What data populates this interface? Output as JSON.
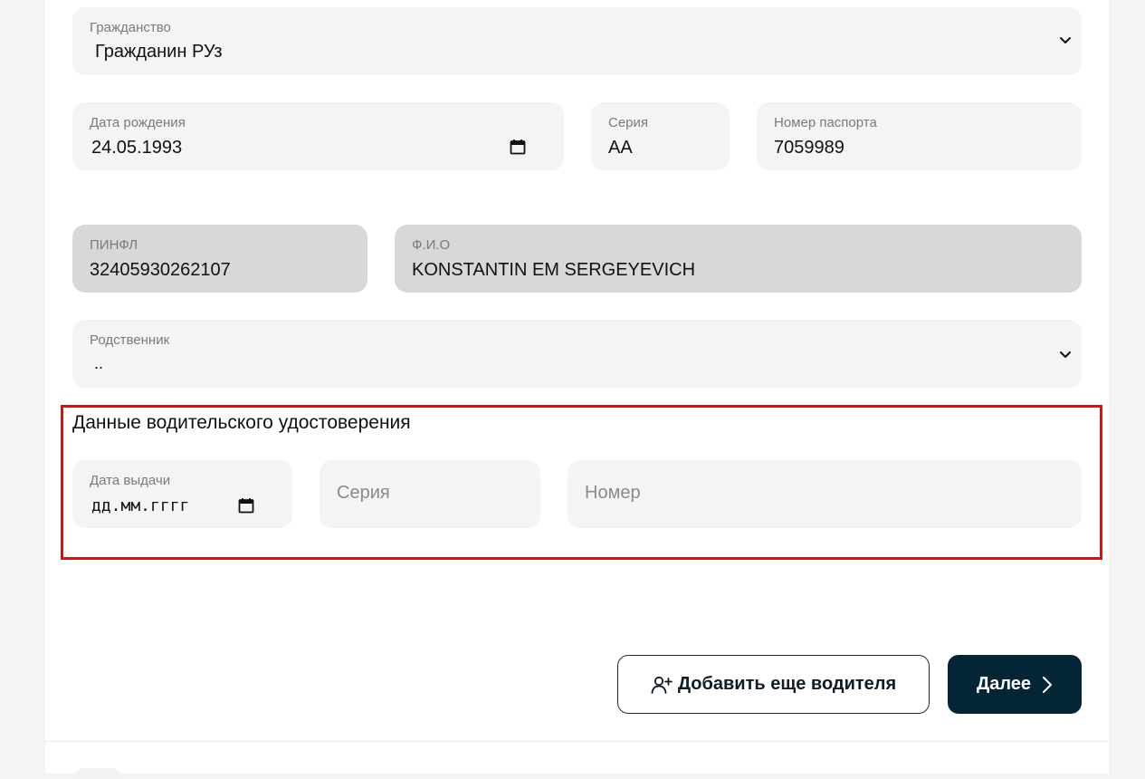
{
  "citizenship": {
    "label": "Гражданство",
    "value": "Гражданин РУз"
  },
  "birth_date": {
    "label": "Дата рождения",
    "value": "24.05.1993"
  },
  "passport_series": {
    "label": "Серия",
    "value": "AA"
  },
  "passport_number": {
    "label": "Номер паспорта",
    "value": "7059989"
  },
  "pinfl": {
    "label": "ПИНФЛ",
    "value": "32405930262107"
  },
  "full_name": {
    "label": "Ф.И.О",
    "value": "KONSTANTIN EM SERGEYEVICH"
  },
  "relative": {
    "label": "Родственник",
    "value": ".."
  },
  "license_section": {
    "title": "Данные водительского удостоверения",
    "issue_date": {
      "label": "Дата выдачи",
      "value": "дд.мм.гггг"
    },
    "series_placeholder": "Серия",
    "number_placeholder": "Номер"
  },
  "actions": {
    "add_driver_label": "Добавить еще водителя",
    "next_label": "Далее"
  },
  "colors": {
    "field_bg": "#f5f4f2",
    "disabled_bg": "#d8d8d8",
    "primary": "#042536",
    "highlight": "#ff0000"
  }
}
